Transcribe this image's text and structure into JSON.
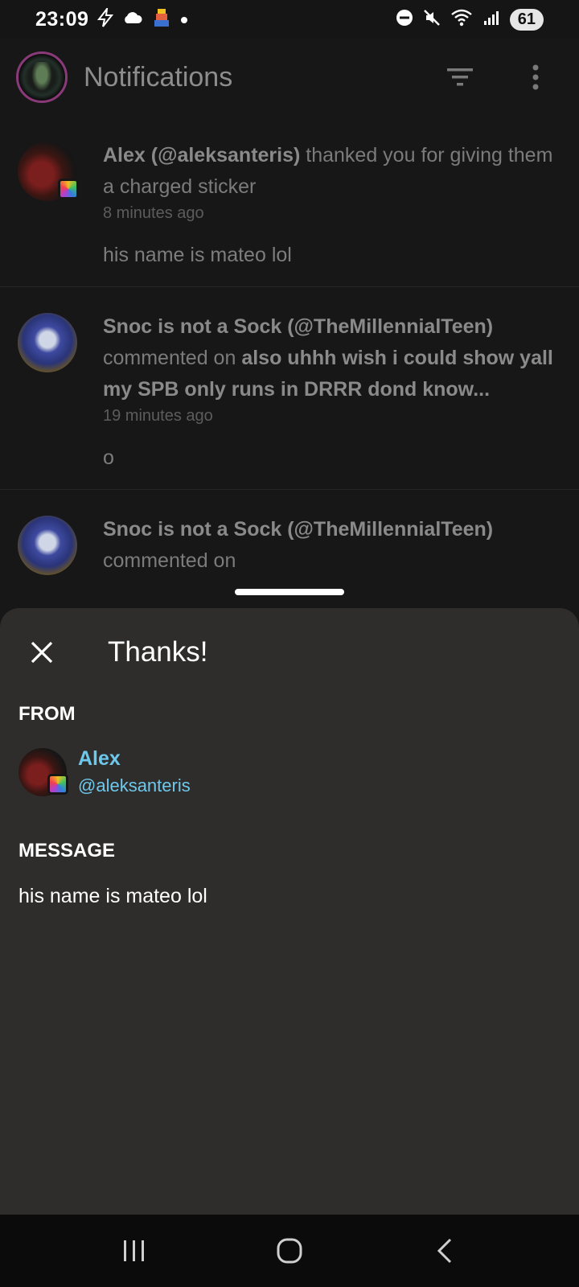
{
  "status_bar": {
    "time": "23:09",
    "battery": "61",
    "left_icons": [
      "bolt-icon",
      "cloud-icon",
      "game-sprite-icon",
      "notification-dot-icon"
    ],
    "right_icons": [
      "dnd-icon",
      "mute-icon",
      "wifi-icon",
      "signal-icon"
    ]
  },
  "appbar": {
    "title": "Notifications"
  },
  "notifications": [
    {
      "user": "Alex (@aleksanteris)",
      "action": " thanked you for giving them a charged sticker",
      "time": "8 minutes ago",
      "body": "his name is mateo lol"
    },
    {
      "user": "Snoc is not a Sock (@TheMillennialTeen)",
      "action": " commented on ",
      "target": "also uhhh wish i could show yall my SPB only runs in DRRR dond know...",
      "time": "19 minutes ago",
      "body": "o"
    },
    {
      "user": "Snoc is not a Sock (@TheMillennialTeen)",
      "action": " commented on"
    }
  ],
  "sheet": {
    "title": "Thanks!",
    "from_label": "FROM",
    "from_name": "Alex",
    "from_handle": "@aleksanteris",
    "message_label": "MESSAGE",
    "message": "his name is mateo lol"
  },
  "colors": {
    "accent_link": "#6ec8ec",
    "sheet_bg": "#2e2d2c",
    "app_bg": "#171717"
  }
}
